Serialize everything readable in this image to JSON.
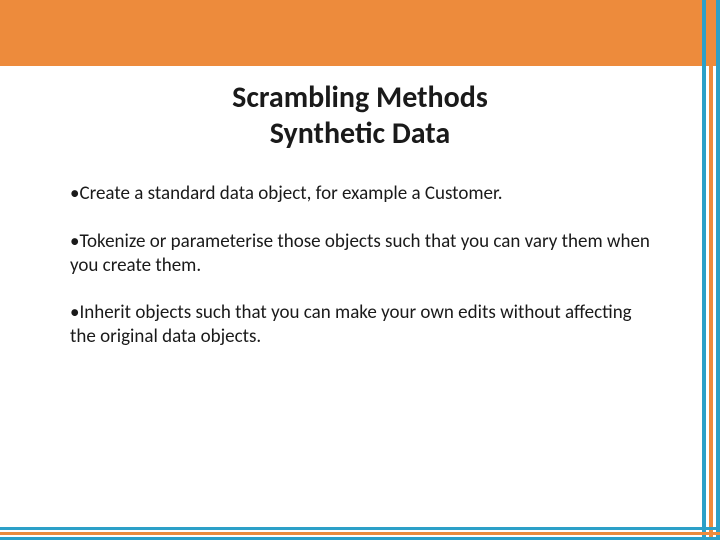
{
  "title": {
    "line1": "Scrambling Methods",
    "line2": "Synthetic Data"
  },
  "bullets": [
    "•Create a standard data object, for example a Customer.",
    "•Tokenize or parameterise those objects such that you can vary them when you create them.",
    "•Inherit objects such that you can make your own edits without affecting the original data objects."
  ]
}
